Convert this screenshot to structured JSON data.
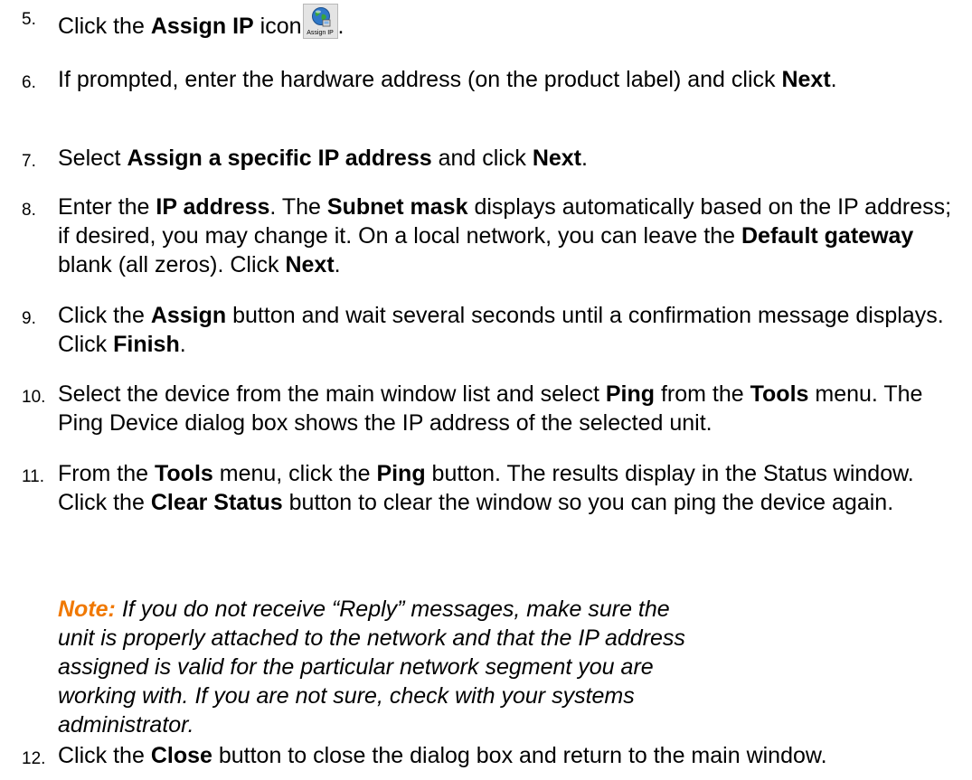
{
  "steps": [
    {
      "num": "5.",
      "parts": [
        {
          "t": "Click the "
        },
        {
          "t": "Assign IP",
          "b": true
        },
        {
          "t": " icon"
        },
        {
          "icon": "assign-ip-icon",
          "caption": "Assign IP"
        },
        {
          "t": "."
        }
      ]
    },
    {
      "num": "6.",
      "parts": [
        {
          "t": "If prompted, enter the hardware address (on the product label) and click "
        },
        {
          "t": "Next",
          "b": true
        },
        {
          "t": "."
        }
      ]
    },
    {
      "num": "7.",
      "parts": [
        {
          "t": "Select "
        },
        {
          "t": "Assign a specific IP address",
          "b": true
        },
        {
          "t": " and click "
        },
        {
          "t": "Next",
          "b": true
        },
        {
          "t": "."
        }
      ]
    },
    {
      "num": "8.",
      "parts": [
        {
          "t": "Enter the "
        },
        {
          "t": "IP address",
          "b": true
        },
        {
          "t": ". The "
        },
        {
          "t": "Subnet mask",
          "b": true
        },
        {
          "t": " displays automatically based on the IP address; if desired, you may change it. On a local network, you can leave the "
        },
        {
          "t": "Default gateway",
          "b": true
        },
        {
          "t": " blank (all zeros). Click "
        },
        {
          "t": "Next",
          "b": true
        },
        {
          "t": "."
        }
      ]
    },
    {
      "num": "9.",
      "parts": [
        {
          "t": "Click the "
        },
        {
          "t": "Assign",
          "b": true
        },
        {
          "t": " button and wait several seconds until a confirmation message displays. Click "
        },
        {
          "t": "Finish",
          "b": true
        },
        {
          "t": "."
        }
      ]
    },
    {
      "num": "10.",
      "parts": [
        {
          "t": "Select the device from the main window list and select "
        },
        {
          "t": "Ping",
          "b": true
        },
        {
          "t": " from the "
        },
        {
          "t": "Tools",
          "b": true
        },
        {
          "t": " menu. The Ping Device dialog box shows the IP address of the selected unit."
        }
      ]
    },
    {
      "num": "11.",
      "parts": [
        {
          "t": "From the "
        },
        {
          "t": "Tools",
          "b": true
        },
        {
          "t": " menu, click the "
        },
        {
          "t": "Ping",
          "b": true
        },
        {
          "t": " button. The results display in the Status window. Click the "
        },
        {
          "t": "Clear Status",
          "b": true
        },
        {
          "t": " button to clear the window so you can ping the device again."
        }
      ]
    },
    {
      "num": "12.",
      "parts": [
        {
          "t": "Click the "
        },
        {
          "t": "Close",
          "b": true
        },
        {
          "t": " button to close the dialog box and return to the main window."
        }
      ]
    }
  ],
  "note": {
    "label": "Note:",
    "text": " If you do not receive “Reply” messages, make sure the unit is properly attached to the network and that the IP address assigned is valid for the particular network segment you are working with. If you are not sure, check with your systems administrator."
  },
  "colors": {
    "note_label": "#f07800",
    "text": "#000000"
  }
}
